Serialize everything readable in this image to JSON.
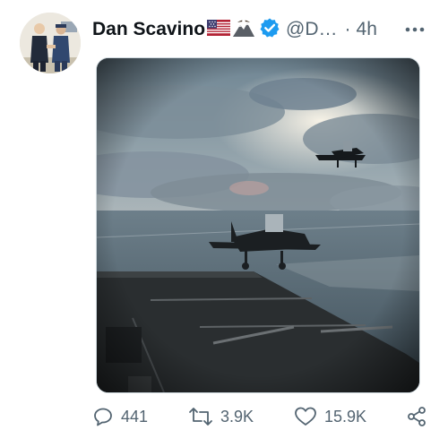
{
  "tweet": {
    "author_name": "Dan Scavino",
    "handle": "@D…",
    "separator": "·",
    "time": "4h",
    "flag_emoji": "us-flag-icon",
    "eagle_emoji": "eagle-mountain-icon",
    "verified_icon": "verified-badge-icon",
    "more_icon": "more-dots-icon",
    "media": {
      "type": "video-frame",
      "subject": "fighter jets landing on aircraft carrier"
    },
    "actions": {
      "reply_count": "441",
      "retweet_count": "3.9K",
      "like_count": "15.9K"
    }
  },
  "colors": {
    "text_primary": "#0f1419",
    "text_secondary": "#536471",
    "verified_blue": "#1d9bf0"
  }
}
